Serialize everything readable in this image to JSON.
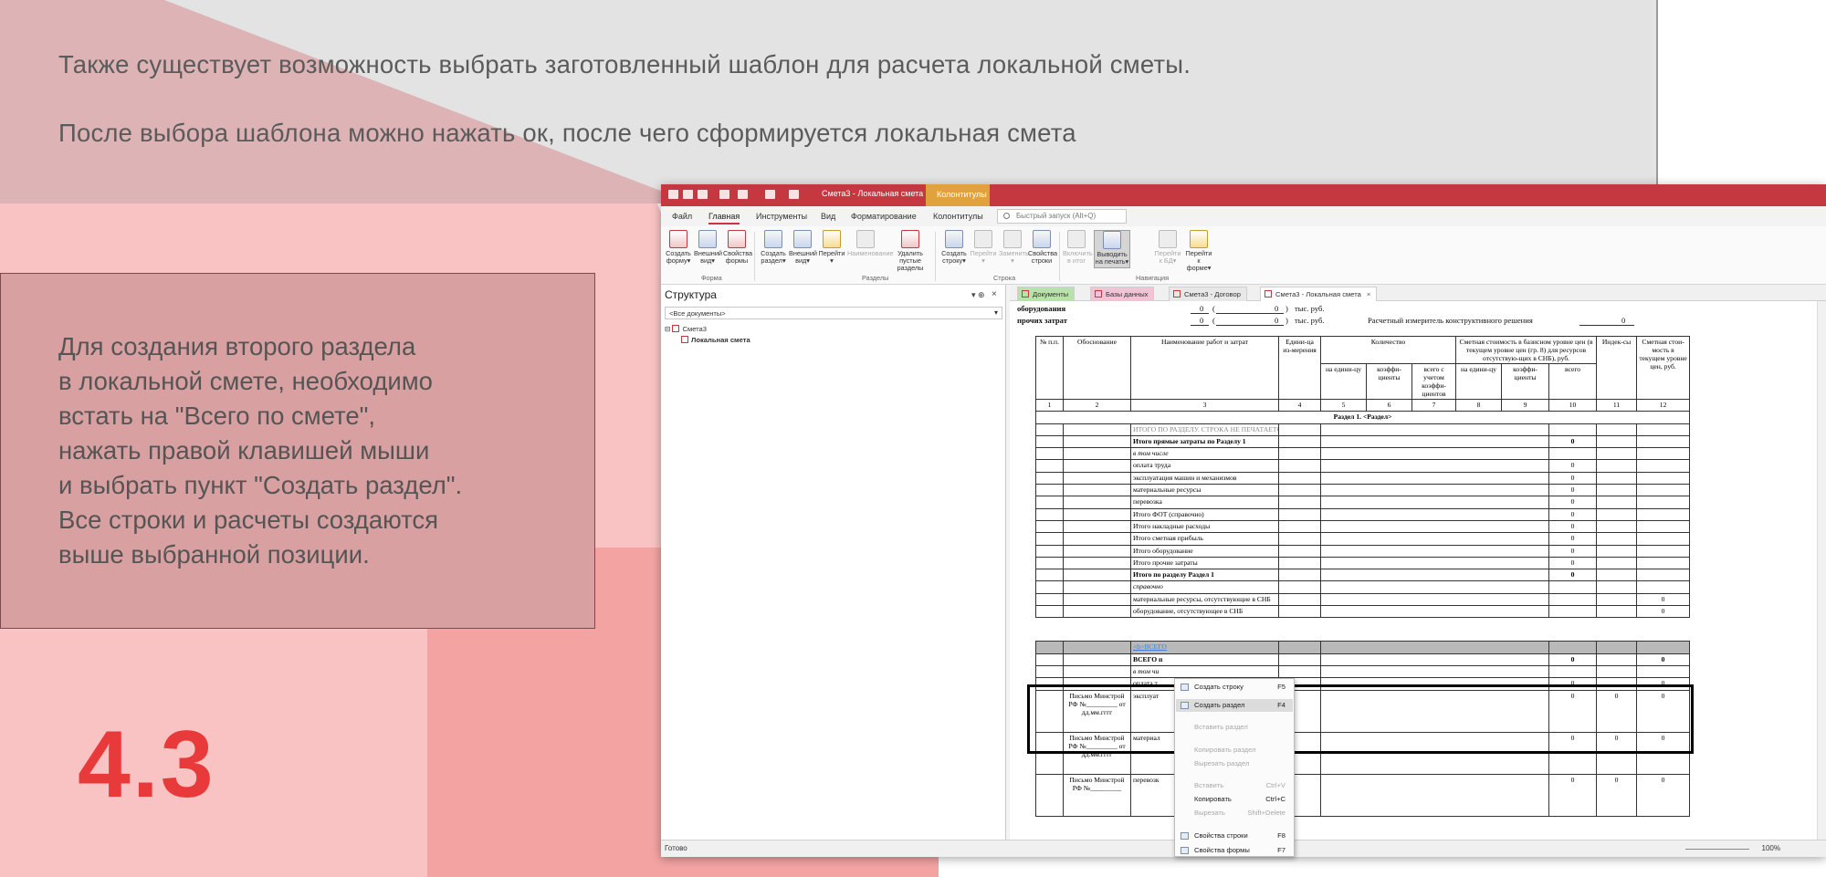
{
  "slide": {
    "intro_line_1": "Также существует возможность выбрать заготовленный шаблон для расчета локальной сметы.",
    "intro_line_2": "После выбора шаблона можно нажать ок, после чего сформируется локальная смета",
    "instructions": "Для создания второго раздела\nв локальной смете, необходимо\nвстать на \"Всего по смете\",\nнажать правой клавишей мыши\nи выбрать пункт \"Создать раздел\".\nВсе строки и расчеты создаются\nвыше выбранной позиции.",
    "slide_number": "4.3"
  },
  "app": {
    "title": "Смета3 - Локальная смета",
    "context_tab": "Колонтитулы",
    "ribbon_tabs": [
      "Файл",
      "Главная",
      "Инструменты",
      "Вид",
      "Форматирование",
      "Колонтитулы"
    ],
    "quick_search_placeholder": "Быстрый запуск (Alt+Q)",
    "ribbon_buttons": [
      "Создать форму▾",
      "Внешний вид▾",
      "Свойства формы",
      "Создать раздел▾",
      "Внешний вид▾",
      "Перейти ▾",
      "Наименование",
      "Удалить пустые разделы",
      "Создать строку▾",
      "Перейти ▾",
      "Заменить ▾",
      "Свойства строки",
      "Включить в итог",
      "Выводить на печать▾",
      "Перейти к БД▾",
      "Перейти к форме▾"
    ],
    "ribbon_groups": [
      "Форма",
      "Разделы",
      "Строка",
      "Навигация"
    ],
    "structure_panel": {
      "title": "Структура",
      "pin": "▾ ⊕",
      "close": "×",
      "filter": "<Все документы>",
      "tree": [
        "Смета3",
        "Локальная смета"
      ]
    },
    "doc_tabs": [
      "Документы",
      "Базы данных",
      "Смета3 - Договор",
      "Смета3 - Локальная смета"
    ],
    "doc_tab_close": "×",
    "header": {
      "equipment_label": "оборудования",
      "other_label": "прочих затрат",
      "equipment_value_1": "0",
      "equipment_value_2": "0",
      "other_value_1": "0",
      "other_value_2": "0",
      "unit": "тыс. руб.",
      "meter_label": "Расчетный измеритель конструктивного решения",
      "meter_value": "0"
    },
    "table": {
      "headers": {
        "num": "№ п.п.",
        "basis": "Обоснование",
        "name": "Наименование работ и затрат",
        "unit": "Едини-ца из-мерения",
        "quantity": "Количество",
        "quantity_sub": [
          "на едини-цу",
          "коэффи-циенты",
          "всего с учетом коэффи-циентов"
        ],
        "cost": "Сметная стоимость в базисном уровне цен (в текущем уровне цен (гр. 8) для ресурсов отсутствую-щих в СНБ), руб.",
        "cost_sub": [
          "на едини-цу",
          "коэффи-циенты",
          "всего"
        ],
        "index": "Индек-сы",
        "current": "Сметная стои-мость в текущем уровне цен, руб."
      },
      "col_numbers": [
        "1",
        "2",
        "3",
        "4",
        "5",
        "6",
        "7",
        "8",
        "9",
        "10",
        "11",
        "12"
      ],
      "section_title": "Раздел 1. <Раздел>",
      "section_rows": [
        {
          "name": "ИТОГО ПО РАЗДЕЛУ. СТРОКА НЕ ПЕЧАТАЕТСЯ.",
          "c10": "",
          "c12": "",
          "style": "gray"
        },
        {
          "name": "Итого прямые затраты по Разделу 1",
          "c10": "0",
          "c12": "",
          "style": "bold"
        },
        {
          "name": "в том числе",
          "c10": "",
          "c12": "",
          "style": "italic"
        },
        {
          "name": "оплата труда",
          "c10": "0",
          "c12": "",
          "style": ""
        },
        {
          "name": "эксплуатация машин и механизмов",
          "c10": "0",
          "c12": "",
          "style": ""
        },
        {
          "name": "материальные ресурсы",
          "c10": "0",
          "c12": "",
          "style": ""
        },
        {
          "name": "перевозка",
          "c10": "0",
          "c12": "",
          "style": ""
        },
        {
          "name": "Итого ФОТ (справочно)",
          "c10": "0",
          "c12": "",
          "style": ""
        },
        {
          "name": "Итого накладные расходы",
          "c10": "0",
          "c12": "",
          "style": ""
        },
        {
          "name": "Итого сметная прибыль",
          "c10": "0",
          "c12": "",
          "style": ""
        },
        {
          "name": "Итого оборудование",
          "c10": "0",
          "c12": "",
          "style": ""
        },
        {
          "name": "Итого прочие затраты",
          "c10": "0",
          "c12": "",
          "style": ""
        },
        {
          "name": "Итого по разделу Раздел 1",
          "c10": "0",
          "c12": "",
          "style": "bold"
        },
        {
          "name": "справочно",
          "c10": "",
          "c12": "",
          "style": "italic"
        },
        {
          "name": "материальные ресурсы, отсутствующие в СНБ",
          "c10": "",
          "c12": "0",
          "style": ""
        },
        {
          "name": "оборудование, отсутствующее в СНБ",
          "c10": "",
          "c12": "0",
          "style": ""
        }
      ],
      "total_rows": [
        {
          "basis": "",
          "name": "<b>ВСЕГО",
          "c10": "",
          "c11": "",
          "c12": "",
          "style": "blue"
        },
        {
          "basis": "",
          "name": "ВСЕГО п",
          "c10": "0",
          "c11": "",
          "c12": "0",
          "style": "bold"
        },
        {
          "basis": "",
          "name": "в том чи",
          "c10": "",
          "c11": "",
          "c12": "",
          "style": "italic"
        },
        {
          "basis": "",
          "name": "оплата т",
          "c10": "0",
          "c11": "",
          "c12": "0",
          "style": ""
        },
        {
          "basis": "Письмо Минстрой РФ №_________ от дд.мм.гггг",
          "name": "эксплуат",
          "c10": "0",
          "c11": "0",
          "c12": "0",
          "style": ""
        },
        {
          "basis": "Письмо Минстрой РФ №_________ от дд.мм.гггг",
          "name": "материал",
          "c10": "0",
          "c11": "0",
          "c12": "0",
          "style": ""
        },
        {
          "basis": "Письмо Минстрой РФ №_________",
          "name": "перевозк",
          "c10": "0",
          "c11": "0",
          "c12": "0",
          "style": ""
        }
      ]
    },
    "context_menu": [
      {
        "label": "Создать строку",
        "shortcut": "F5",
        "enabled": true,
        "highlighted": false,
        "icon": "add-row-icon"
      },
      {
        "label": "Создать раздел",
        "shortcut": "F4",
        "enabled": true,
        "highlighted": true,
        "icon": "add-section-icon"
      },
      {
        "label": "Вставить раздел",
        "shortcut": "",
        "enabled": false,
        "highlighted": false,
        "icon": ""
      },
      {
        "label": "Копировать раздел",
        "shortcut": "",
        "enabled": false,
        "highlighted": false,
        "icon": ""
      },
      {
        "label": "Вырезать раздел",
        "shortcut": "",
        "enabled": false,
        "highlighted": false,
        "icon": ""
      },
      {
        "label": "Вставить",
        "shortcut": "Ctrl+V",
        "enabled": false,
        "highlighted": false,
        "icon": ""
      },
      {
        "label": "Копировать",
        "shortcut": "Ctrl+C",
        "enabled": true,
        "highlighted": false,
        "icon": ""
      },
      {
        "label": "Вырезать",
        "shortcut": "Shift+Delete",
        "enabled": false,
        "highlighted": false,
        "icon": ""
      },
      {
        "label": "Свойства строки",
        "shortcut": "F8",
        "enabled": true,
        "highlighted": false,
        "icon": "row-properties-icon"
      },
      {
        "label": "Свойства формы",
        "shortcut": "F7",
        "enabled": true,
        "highlighted": false,
        "icon": "form-properties-icon"
      }
    ],
    "status": "Готово",
    "zoom": "100%"
  },
  "colors": {
    "titlebar": "#c6383f",
    "context_tab": "#e0a23c",
    "slide_number": "#e83a3a",
    "pink": "#f9c3c3"
  }
}
